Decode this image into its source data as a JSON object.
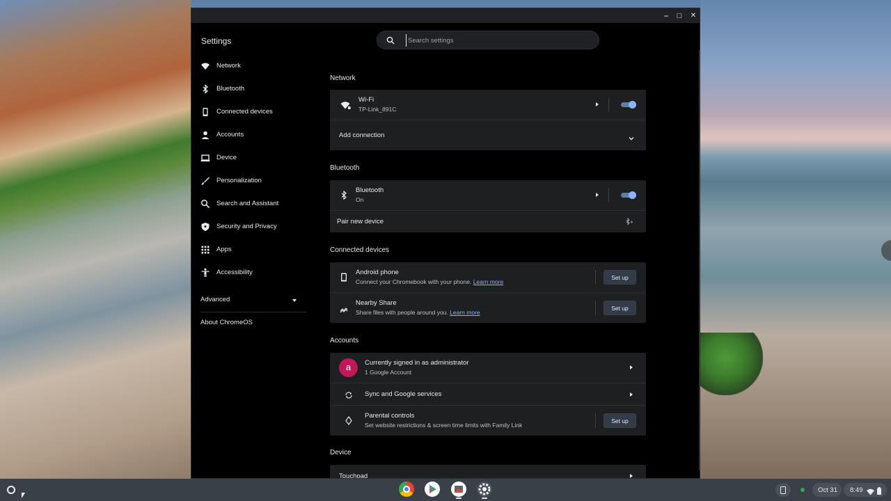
{
  "window": {
    "app_title": "Settings",
    "minimize": "−",
    "maximize": "□",
    "close": "✕"
  },
  "search": {
    "placeholder": "Search settings"
  },
  "sidebar": {
    "items": [
      {
        "label": "Network",
        "icon": "wifi-icon"
      },
      {
        "label": "Bluetooth",
        "icon": "bluetooth-icon"
      },
      {
        "label": "Connected devices",
        "icon": "phone-icon"
      },
      {
        "label": "Accounts",
        "icon": "person-icon"
      },
      {
        "label": "Device",
        "icon": "laptop-icon"
      },
      {
        "label": "Personalization",
        "icon": "brush-icon"
      },
      {
        "label": "Search and Assistant",
        "icon": "search-icon"
      },
      {
        "label": "Security and Privacy",
        "icon": "shield-icon"
      },
      {
        "label": "Apps",
        "icon": "apps-grid-icon"
      },
      {
        "label": "Accessibility",
        "icon": "accessibility-icon"
      }
    ],
    "advanced": "Advanced",
    "about": "About ChromeOS"
  },
  "main": {
    "network": {
      "title": "Network",
      "wifi_title": "Wi-Fi",
      "wifi_sub": "TP-Link_891C",
      "wifi_enabled": true,
      "add_connection": "Add connection"
    },
    "bluetooth": {
      "title": "Bluetooth",
      "bt_title": "Bluetooth",
      "bt_sub": "On",
      "bt_enabled": true,
      "pair_new": "Pair new device"
    },
    "connected": {
      "title": "Connected devices",
      "android_title": "Android phone",
      "android_sub": "Connect your Chromebook with your phone.",
      "android_link": "Learn more",
      "android_button": "Set up",
      "nearby_title": "Nearby Share",
      "nearby_sub": "Share files with people around you.",
      "nearby_link": "Learn more",
      "nearby_button": "Set up"
    },
    "accounts": {
      "title": "Accounts",
      "avatar_letter": "a",
      "signed_in_title": "Currently signed in as administrator",
      "signed_in_sub": "1 Google Account",
      "sync": "Sync and Google services",
      "parental_title": "Parental controls",
      "parental_sub": "Set website restrictions & screen time limits with Family Link",
      "parental_button": "Set up"
    },
    "device": {
      "title": "Device",
      "touchpad": "Touchpad"
    }
  },
  "shelf": {
    "apps": [
      "chrome-icon",
      "play-store-icon",
      "gallery-icon",
      "settings-app-icon"
    ],
    "date": "Oct 31",
    "time": "8:49"
  },
  "colors": {
    "accent": "#8ab4f8",
    "card_bg": "#1e1f21",
    "window_bg": "#000000",
    "avatar": "#c2185b"
  }
}
